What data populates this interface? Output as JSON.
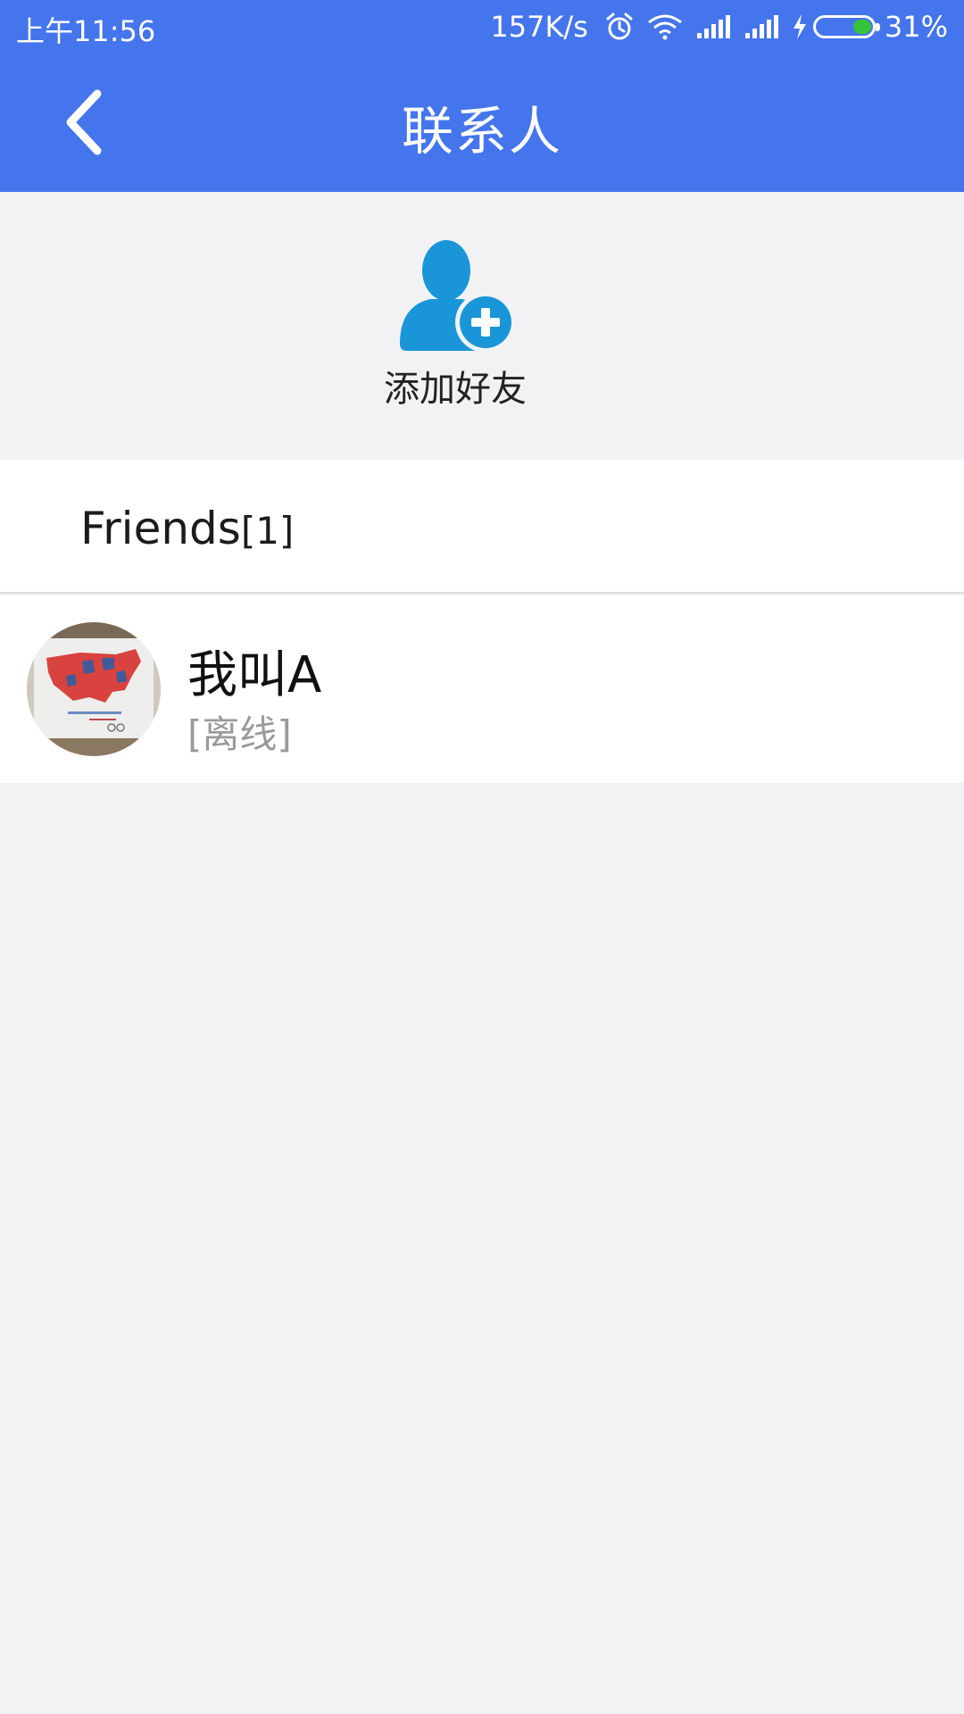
{
  "status_bar": {
    "time": "上午11:56",
    "net_speed": "157K/s",
    "battery_percent": "31%",
    "battery_level": 0.31,
    "icons": [
      "alarm-icon",
      "wifi-icon",
      "signal-icon",
      "signal-icon",
      "charging-icon",
      "battery-icon"
    ]
  },
  "toolbar": {
    "title": "联系人",
    "back_icon": "chevron-left-icon",
    "color": "#4575ec"
  },
  "add_friend": {
    "label": "添加好友",
    "icon": "add-user-icon",
    "icon_color": "#1a96d8"
  },
  "group": {
    "name": "Friends",
    "count": "[1]"
  },
  "contacts": [
    {
      "name": "我叫A",
      "status": "[离线]",
      "avatar": "avatar-photo-map"
    }
  ]
}
